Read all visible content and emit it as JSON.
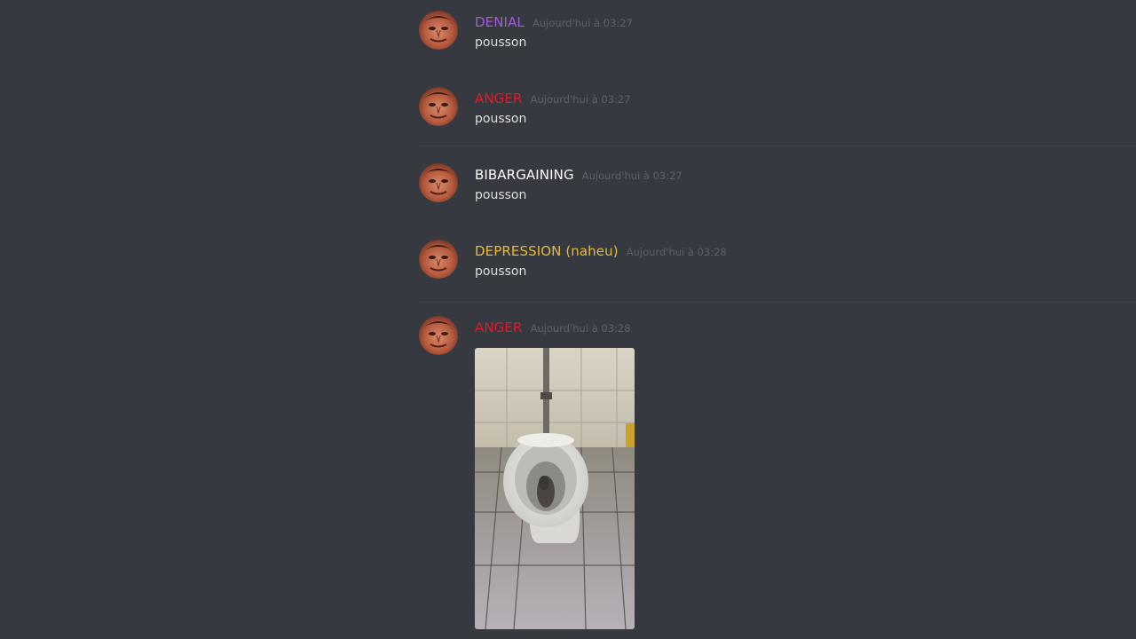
{
  "messages": [
    {
      "username": "DENIAL",
      "username_color": "#a45bd6",
      "timestamp": "Aujourd'hui à 03:27",
      "content": "pousson"
    },
    {
      "username": "ANGER",
      "username_color": "#d81d2e",
      "timestamp": "Aujourd'hui à 03:27",
      "content": "pousson"
    },
    {
      "username": "BIBARGAINING",
      "username_color": "#ffffff",
      "timestamp": "Aujourd'hui à 03:27",
      "content": "pousson"
    },
    {
      "username": "DEPRESSION (naheu)",
      "username_color": "#e8b93a",
      "timestamp": "Aujourd'hui à 03:28",
      "content": "pousson"
    },
    {
      "username": "ANGER",
      "username_color": "#d81d2e",
      "timestamp": "Aujourd'hui à 03:28",
      "attachment": "toilet-photo"
    }
  ],
  "colors": {
    "background": "#36393f",
    "message_text": "#dcddde",
    "timestamp_text": "#5d6167"
  }
}
